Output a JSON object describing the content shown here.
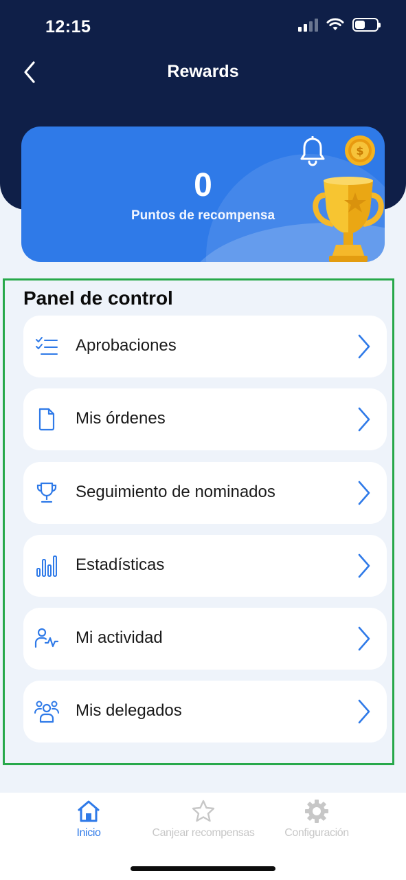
{
  "status_bar": {
    "time": "12:15"
  },
  "nav": {
    "title": "Rewards",
    "back_icon": "chevron-left-icon"
  },
  "rewards_card": {
    "points": "0",
    "points_label": "Puntos de recompensa",
    "bell_icon": "bell-icon",
    "coin_icon": "coin-icon",
    "trophy_icon": "trophy-icon"
  },
  "panel": {
    "title": "Panel de control",
    "items": [
      {
        "label": "Aprobaciones",
        "icon": "checklist-icon"
      },
      {
        "label": "Mis órdenes",
        "icon": "document-icon"
      },
      {
        "label": "Seguimiento de nominados",
        "icon": "trophy-icon"
      },
      {
        "label": "Estadísticas",
        "icon": "bar-chart-icon"
      },
      {
        "label": "Mi actividad",
        "icon": "user-activity-icon"
      },
      {
        "label": "Mis delegados",
        "icon": "group-icon"
      }
    ]
  },
  "tabbar": {
    "tabs": [
      {
        "label": "Inicio",
        "icon": "home-icon",
        "active": true
      },
      {
        "label": "Canjear recompensas",
        "icon": "star-icon",
        "active": false
      },
      {
        "label": "Configuración",
        "icon": "gear-icon",
        "active": false
      }
    ]
  },
  "colors": {
    "header": "#0f1f48",
    "accent": "#2f7ae8",
    "background": "#eef3fa",
    "highlight_border": "#27a84a"
  }
}
